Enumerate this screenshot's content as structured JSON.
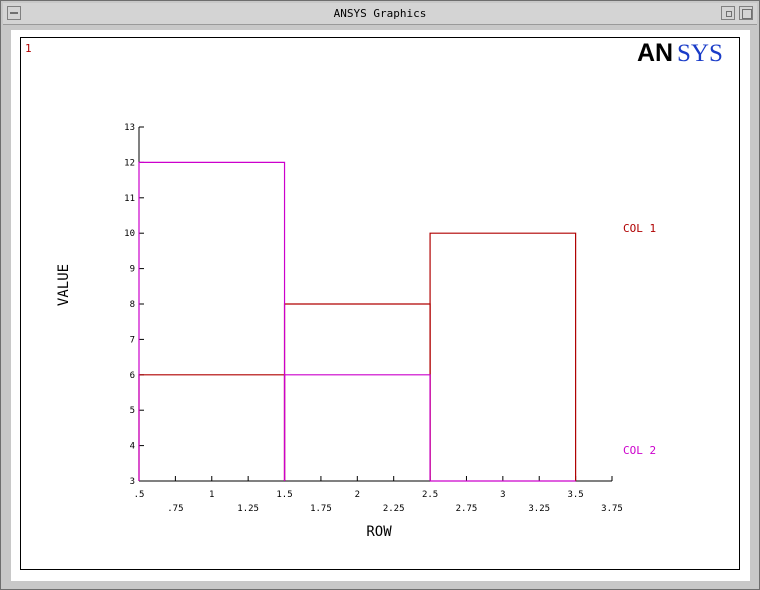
{
  "window": {
    "title": "ANSYS Graphics"
  },
  "viewport": {
    "number": "1"
  },
  "logo": {
    "part1": "AN",
    "part2": "SYS"
  },
  "colors": {
    "col1": "#b00000",
    "col2": "#cc00cc",
    "logo_dark": "#000000",
    "logo_blue": "#1a3cc8"
  },
  "chart_data": {
    "type": "bar",
    "xlabel": "ROW",
    "ylabel": "VALUE",
    "xlim": [
      0.5,
      3.75
    ],
    "ylim": [
      3,
      13
    ],
    "x_ticks_major": [
      ".5",
      "1",
      "1.5",
      "2",
      "2.5",
      "3",
      "3.5"
    ],
    "x_ticks_minor": [
      ".75",
      "1.25",
      "1.75",
      "2.25",
      "2.75",
      "3.25",
      "3.75"
    ],
    "y_ticks": [
      "3",
      "4",
      "5",
      "6",
      "7",
      "8",
      "9",
      "10",
      "11",
      "12",
      "13"
    ],
    "bins": [
      [
        0.5,
        1.5
      ],
      [
        1.5,
        2.5
      ],
      [
        2.5,
        3.5
      ]
    ],
    "series": [
      {
        "name": "COL  1",
        "values": [
          6,
          8,
          10
        ]
      },
      {
        "name": "COL  2",
        "values": [
          12,
          6,
          3
        ]
      }
    ]
  }
}
